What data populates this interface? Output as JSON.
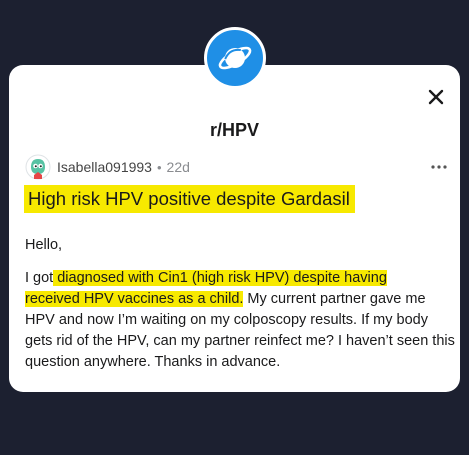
{
  "subreddit": {
    "name": "r/HPV",
    "icon": "planet-icon"
  },
  "post": {
    "author": "Isabella091993",
    "separator": "•",
    "age": "22d",
    "title": "High risk HPV positive despite Gardasil",
    "greeting": "Hello,",
    "body_prefix": "I got",
    "body_highlight_1": " diagnosed with Cin1 (high risk HPV) despite having",
    "body_highlight_2": "received HPV vaccines as a child.",
    "body_rest": " My current partner gave me HPV and now I’m waiting on my colposcopy results. If my body gets rid of the HPV, can my partner reinfect me? I haven’t seen this question anywhere. Thanks in advance."
  },
  "colors": {
    "highlight": "#f7e900",
    "accent": "#1f8fe6",
    "background": "#1c2030"
  },
  "icons": {
    "close": "close-icon",
    "more": "more-icon",
    "avatar": "avatar"
  }
}
